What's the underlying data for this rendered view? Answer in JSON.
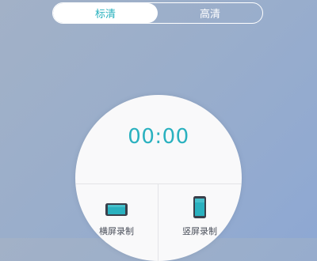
{
  "quality_toggle": {
    "options": [
      {
        "label": "标清",
        "selected": true
      },
      {
        "label": "高清",
        "selected": false
      }
    ]
  },
  "recorder": {
    "timer": "00:00",
    "landscape_label": "横屏录制",
    "portrait_label": "竖屏录制",
    "landscape_icon": "landscape-phone-icon",
    "portrait_icon": "portrait-phone-icon"
  },
  "colors": {
    "accent": "#2ab1bf",
    "background_start": "#a2b1c7",
    "background_end": "#8ea8d3",
    "dial": "#f9f9fa"
  }
}
